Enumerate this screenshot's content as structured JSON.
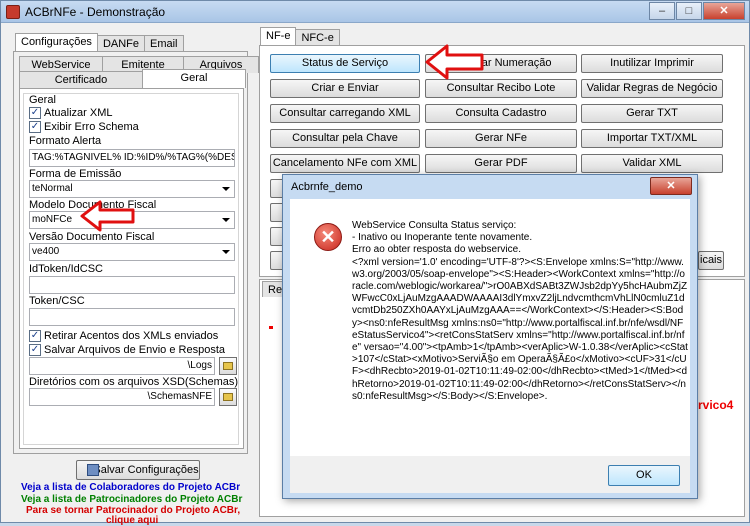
{
  "window": {
    "title": "ACBrNFe - Demonstração",
    "minimize": "–",
    "maximize": "□",
    "close": "✕"
  },
  "left_tabs": {
    "top": [
      "Configurações",
      "DANFe",
      "Email"
    ],
    "row2": [
      "WebService",
      "Emitente",
      "Arquivos"
    ],
    "row3": [
      "Certificado",
      "Geral"
    ]
  },
  "geral": {
    "group_label": "Geral",
    "chk_atualizar": "Atualizar XML",
    "chk_exibir": "Exibir Erro Schema",
    "formato_label": "Formato Alerta",
    "formato_value": "TAG:%TAGNIVEL% ID:%ID%/%TAG%(%DESCRICA",
    "forma_label": "Forma de Emissão",
    "forma_value": "teNormal",
    "modelo_label": "Modelo Documento Fiscal",
    "modelo_value": "moNFCe",
    "versao_label": "Versão Documento Fiscal",
    "versao_value": "ve400",
    "idtoken_label": "IdToken/IdCSC",
    "idtoken_value": "",
    "token_label": "Token/CSC",
    "token_value": "",
    "chk_retirar": "Retirar Acentos dos XMLs enviados",
    "chk_salvar": "Salvar Arquivos de Envio e Resposta",
    "logs_value": "\\Logs",
    "xsd_label": "Diretórios com os arquivos XSD(Schemas)",
    "xsd_value": "\\SchemasNFE",
    "check_mark": "✓"
  },
  "salvar_button": "Salvar Configurações",
  "links": {
    "colaboradores": "Veja a lista de Colaboradores do Projeto ACBr",
    "patrocinadores": "Veja a lista de Patrocinadores do Projeto ACBr",
    "patrocinador1": "Para se tornar Patrocinador do Projeto ACBr,",
    "patrocinador2": "clique aqui"
  },
  "right_tabs": [
    "NF-e",
    "NFC-e"
  ],
  "buttons": [
    [
      "Status de Serviço",
      "Inutilizar Numeração",
      "Inutilizar Imprimir"
    ],
    [
      "Criar e Enviar",
      "Consultar Recibo Lote",
      "Validar Regras de Negócio"
    ],
    [
      "Consultar carregando XML",
      "Consulta Cadastro",
      "Gerar TXT"
    ],
    [
      "Consultar pela Chave",
      "Gerar NFe",
      "Importar TXT/XML"
    ],
    [
      "Cancelamento NFe com XML",
      "Gerar PDF",
      "Validar XML"
    ]
  ],
  "partial_texts": {
    "res": "Res",
    "cais": "icais",
    "red": "rvico4"
  },
  "dialog": {
    "title": "Acbrnfe_demo",
    "close": "✕",
    "icon": "✕",
    "message": "WebService Consulta Status serviço:\n- Inativo ou Inoperante tente novamente.\nErro ao obter resposta do webservice.\n<?xml version='1.0' encoding='UTF-8'?><S:Envelope xmlns:S=\"http://www.w3.org/2003/05/soap-envelope\"><S:Header><WorkContext xmlns=\"http://oracle.com/weblogic/workarea/\">rO0ABXdSABt3ZWJsb2dpYy5hcHAubmZjZWFwcC0xLjAuMzgAAADWAAAAI3dlYmxvZ2ljLndvcmthcmVhLlN0cmluZ1dvcmtDb250ZXh0AAYxLjAuMzgAAA==</WorkContext></S:Header><S:Body><ns0:nfeResultMsg xmlns:ns0=\"http://www.portalfiscal.inf.br/nfe/wsdl/NFeStatusServico4\"><retConsStatServ xmlns=\"http://www.portalfiscal.inf.br/nfe\" versao=\"4.00\"><tpAmb>1</tpAmb><verAplic>W-1.0.38</verAplic><cStat>107</cStat><xMotivo>ServiÃ§o em OperaÃ§Ã£o</xMotivo><cUF>31</cUF><dhRecbto>2019-01-02T10:11:49-02:00</dhRecbto><tMed>1</tMed><dhRetorno>2019-01-02T10:11:49-02:00</dhRetorno></retConsStatServ></ns0:nfeResultMsg></S:Body></S:Envelope>.",
    "ok": "OK"
  },
  "colors": {
    "link_blue": "#0000cc",
    "link_green": "#008000",
    "link_red": "#d40000",
    "arrow_red": "#e01010"
  }
}
